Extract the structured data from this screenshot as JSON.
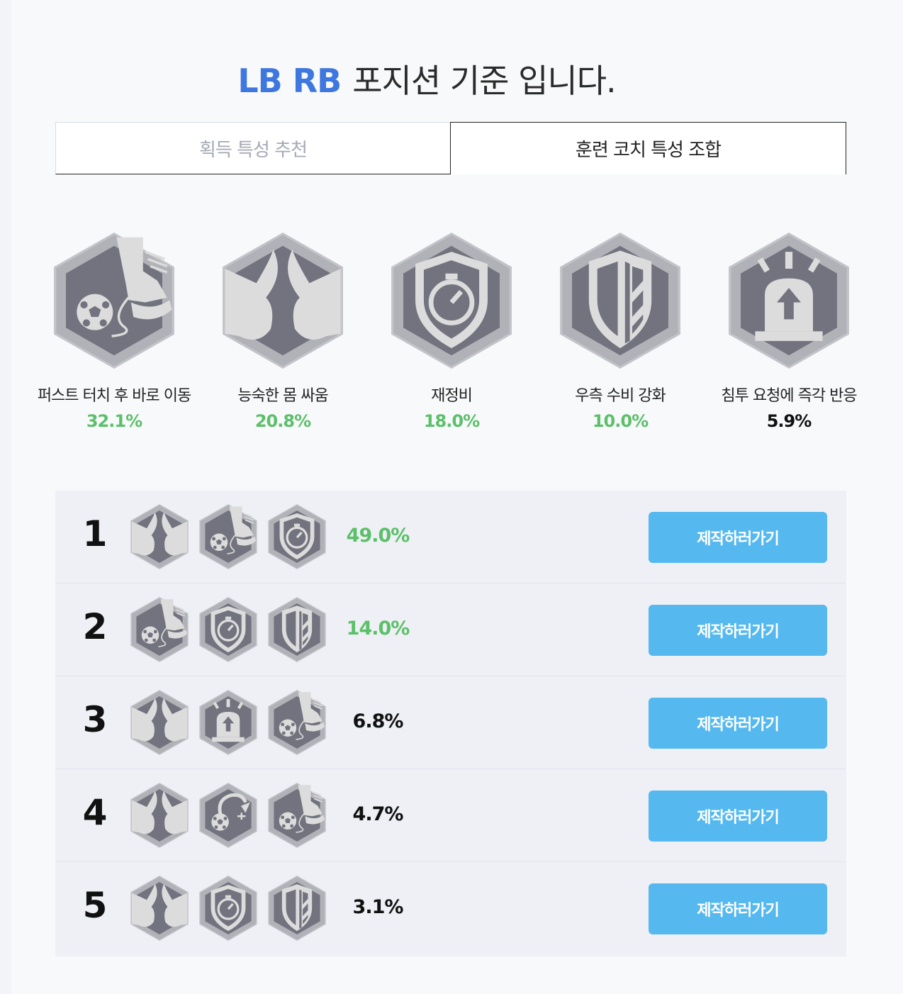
{
  "header": {
    "position_label": "LB RB",
    "title_rest": "포지션 기준 입니다."
  },
  "tabs": [
    {
      "label": "획득 특성 추천",
      "active": false
    },
    {
      "label": "훈련 코치 특성 조합",
      "active": true
    }
  ],
  "colors": {
    "accent_blue": "#3d77df",
    "pct_green": "#5cc06a",
    "button_blue": "#55b9f0",
    "icon_dark": "#73737f",
    "icon_light": "#dcdcdc"
  },
  "traits": [
    {
      "name": "퍼스트 터치 후 바로 이동",
      "percent": "32.1%",
      "icon": "first-touch-icon",
      "highlight": true
    },
    {
      "name": "능숙한 몸 싸움",
      "percent": "20.8%",
      "icon": "physical-battle-icon",
      "highlight": true
    },
    {
      "name": "재정비",
      "percent": "18.0%",
      "icon": "stopwatch-shield-icon",
      "highlight": true
    },
    {
      "name": "우측 수비 강화",
      "percent": "10.0%",
      "icon": "striped-shield-icon",
      "highlight": true
    },
    {
      "name": "침투 요청에 즉각 반응",
      "percent": "5.9%",
      "icon": "siren-icon",
      "highlight": false
    }
  ],
  "combos": [
    {
      "rank": "1",
      "icons": [
        "physical-battle-icon",
        "first-touch-icon",
        "stopwatch-shield-icon"
      ],
      "percent": "49.0%",
      "highlight": true,
      "button_label": "제작하러가기"
    },
    {
      "rank": "2",
      "icons": [
        "first-touch-icon",
        "stopwatch-shield-icon",
        "striped-shield-icon"
      ],
      "percent": "14.0%",
      "highlight": true,
      "button_label": "제작하러가기"
    },
    {
      "rank": "3",
      "icons": [
        "physical-battle-icon",
        "siren-icon",
        "first-touch-icon"
      ],
      "percent": "6.8%",
      "highlight": false,
      "button_label": "제작하러가기"
    },
    {
      "rank": "4",
      "icons": [
        "physical-battle-icon",
        "ball-curve-icon",
        "first-touch-icon"
      ],
      "percent": "4.7%",
      "highlight": false,
      "button_label": "제작하러가기"
    },
    {
      "rank": "5",
      "icons": [
        "physical-battle-icon",
        "stopwatch-shield-icon",
        "striped-shield-icon"
      ],
      "percent": "3.1%",
      "highlight": false,
      "button_label": "제작하러가기"
    }
  ]
}
